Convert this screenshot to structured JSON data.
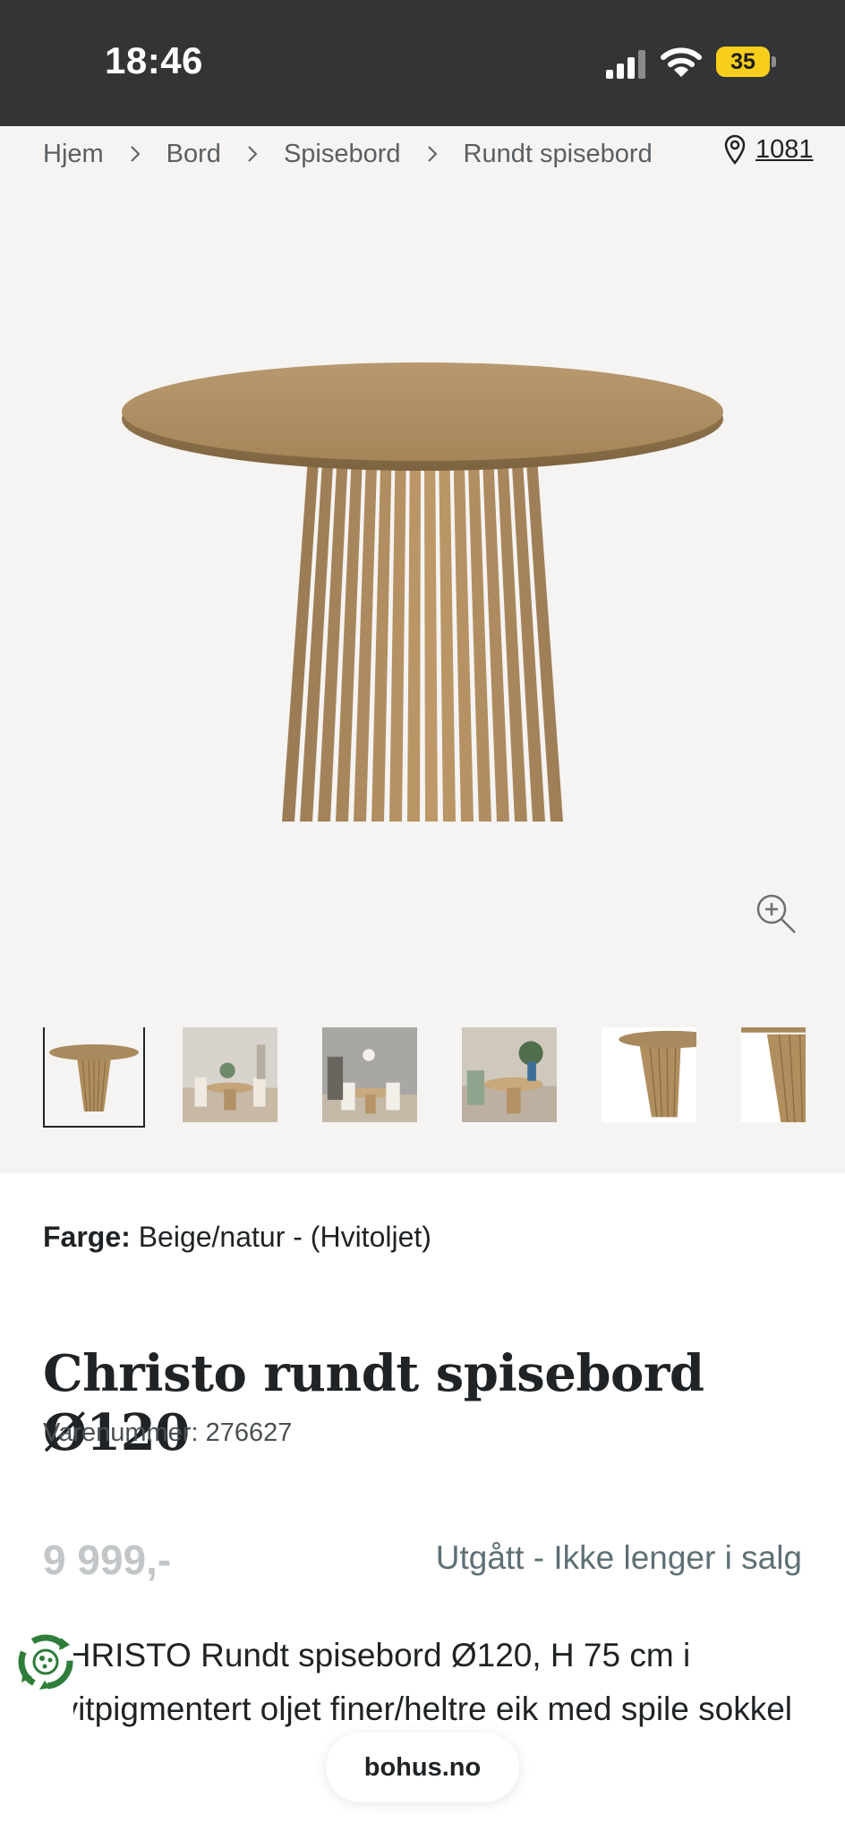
{
  "status_bar": {
    "time": "18:46",
    "battery_level": "35",
    "battery_color": "#f7ce1b"
  },
  "breadcrumb": [
    "Hjem",
    "Bord",
    "Spisebord",
    "Rundt spisebord"
  ],
  "store": {
    "code": "1081",
    "icon": "location-pin-icon"
  },
  "gallery": {
    "zoom_icon": "zoom-in-icon",
    "thumbnail_count": 6,
    "selected_index": 0
  },
  "product": {
    "color_label": "Farge:",
    "color_value": "Beige/natur - (Hvitoljet)",
    "title": "Christo rundt spisebord Ø120",
    "sku": "Varenummer: 276627",
    "price": "9 999,-",
    "availability": "Utgått - Ikke lenger i salg",
    "description": "CHRISTO Rundt spisebord Ø120, H 75 cm i hvitpigmentert oljet finer/heltre eik med spile sokkel"
  },
  "browser": {
    "url": "bohus.no"
  },
  "colors": {
    "status_bar_bg": "#333436",
    "gallery_bg": "#f6f4f2",
    "availability_text": "#5e7076",
    "price_disabled": "#c3c6c8"
  }
}
